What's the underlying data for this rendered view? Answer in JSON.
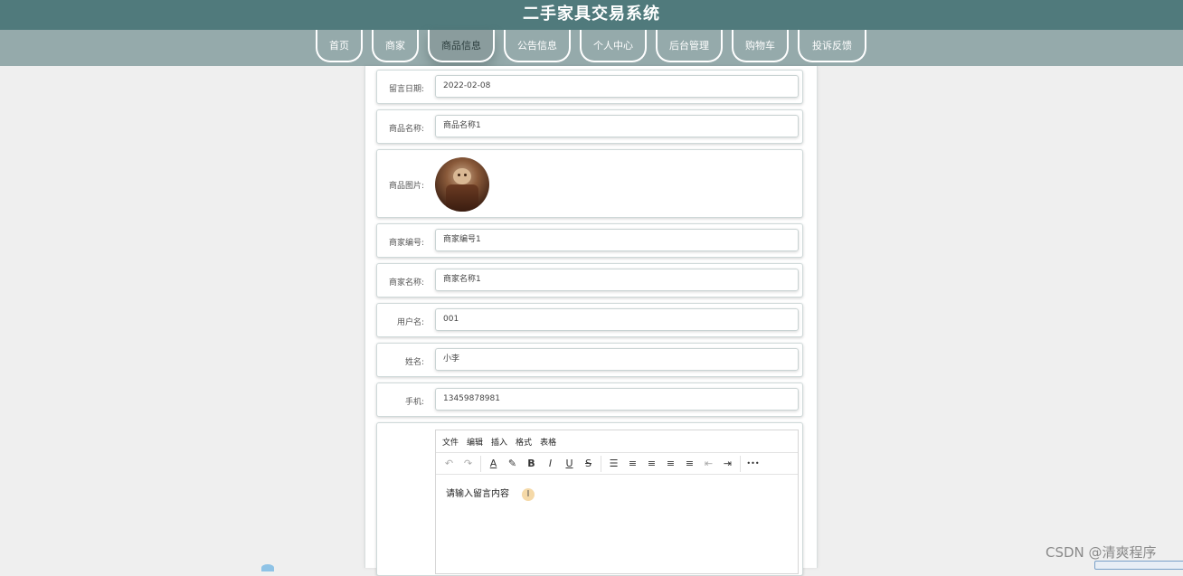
{
  "header": {
    "title": "二手家具交易系统"
  },
  "nav": {
    "items": [
      {
        "label": "首页"
      },
      {
        "label": "商家"
      },
      {
        "label": "商品信息"
      },
      {
        "label": "公告信息"
      },
      {
        "label": "个人中心"
      },
      {
        "label": "后台管理"
      },
      {
        "label": "购物车"
      },
      {
        "label": "投诉反馈"
      }
    ],
    "active_index": 2
  },
  "form": {
    "date": {
      "label": "留言日期:",
      "value": "2022-02-08"
    },
    "product_name": {
      "label": "商品名称:",
      "value": "商品名称1"
    },
    "product_image": {
      "label": "商品图片:"
    },
    "merchant_no": {
      "label": "商家编号:",
      "value": "商家编号1"
    },
    "merchant_name": {
      "label": "商家名称:",
      "value": "商家名称1"
    },
    "username": {
      "label": "用户名:",
      "value": "001"
    },
    "name": {
      "label": "姓名:",
      "value": "小李"
    },
    "phone": {
      "label": "手机:",
      "value": "13459878981"
    }
  },
  "editor": {
    "menu": [
      "文件",
      "编辑",
      "插入",
      "格式",
      "表格"
    ],
    "toolbar": {
      "undo": "↶",
      "redo": "↷",
      "font_color": "A",
      "highlight": "✎",
      "bold": "B",
      "italic": "I",
      "underline": "U",
      "strike": "S",
      "list": "☰",
      "align_left": "≡",
      "align_center": "≡",
      "align_right": "≡",
      "justify": "≡",
      "outdent": "⇤",
      "indent": "⇥",
      "more": "•••"
    },
    "placeholder": "请输入留言内容"
  },
  "watermark": "CSDN @清爽程序"
}
